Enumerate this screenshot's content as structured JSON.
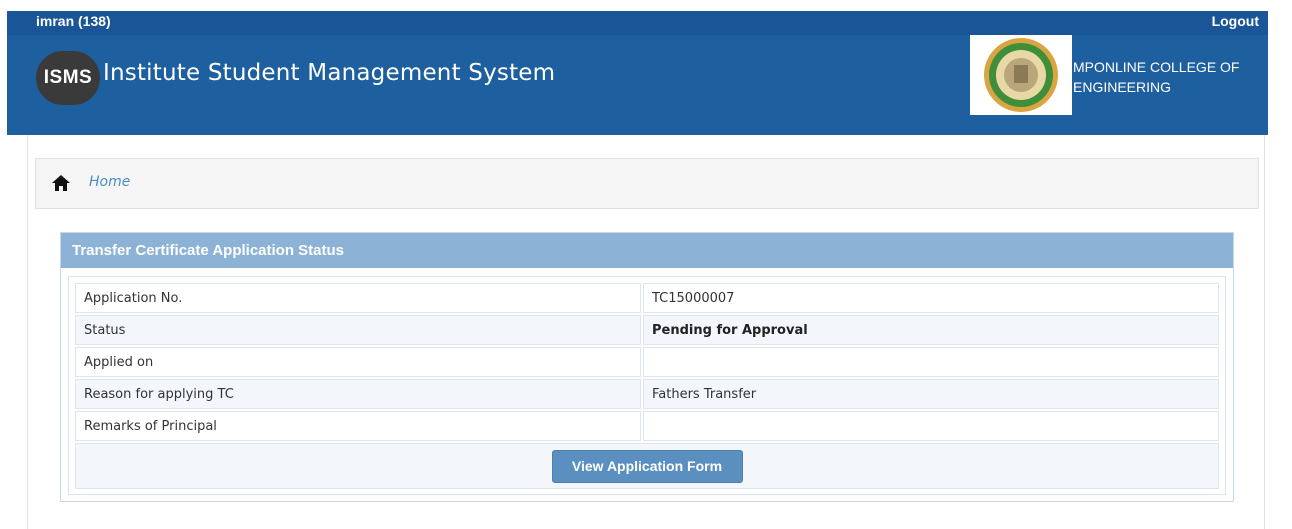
{
  "topbar": {
    "user": "imran  (138)",
    "logout": "Logout"
  },
  "header": {
    "logo_text": "ISMS",
    "app_title": "Institute Student Management System",
    "college_name": "MPONLINE COLLEGE OF ENGINEERING"
  },
  "breadcrumb": {
    "home": "Home"
  },
  "panel": {
    "title": "Transfer Certificate Application Status",
    "rows": [
      {
        "label": "Application No.",
        "value": "TC15000007"
      },
      {
        "label": "Status",
        "value": "Pending for Approval"
      },
      {
        "label": "Applied on",
        "value": ""
      },
      {
        "label": "Reason for applying TC",
        "value": "Fathers Transfer"
      },
      {
        "label": "Remarks of Principal",
        "value": ""
      }
    ],
    "button": "View Application Form"
  },
  "colors": {
    "topbar": "#1a5597",
    "header": "#1d5f9f",
    "panel_header": "#8cb3d6",
    "button": "#5b8fc0",
    "link": "#4c8fbd"
  },
  "icons": {
    "home": "home-icon",
    "emblem": "college-emblem"
  }
}
